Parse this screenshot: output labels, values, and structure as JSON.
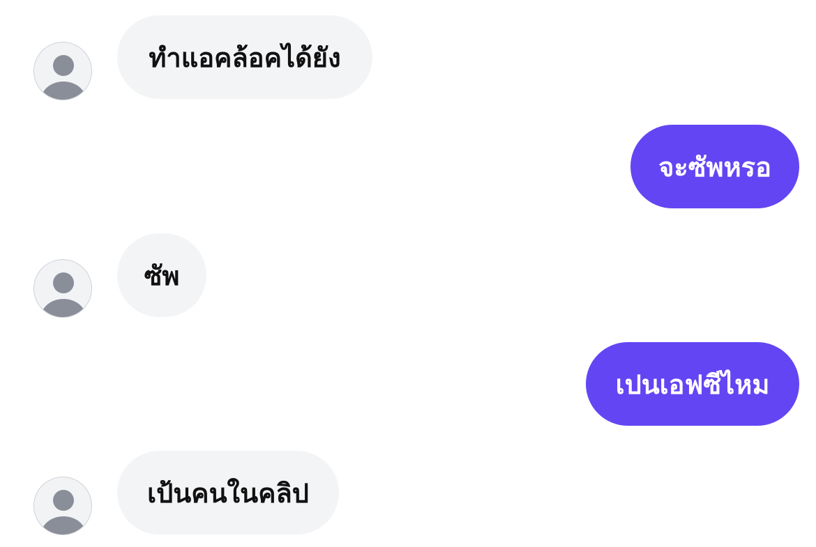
{
  "colors": {
    "incoming_bubble": "#f3f4f6",
    "outgoing_bubble": "#6445f3",
    "incoming_text": "#111111",
    "outgoing_text": "#ffffff",
    "avatar_figure": "#8a8e99"
  },
  "messages": [
    {
      "direction": "incoming",
      "text": "ทำแอคล้อคได้ยัง",
      "avatar": "default-user-icon"
    },
    {
      "direction": "outgoing",
      "text": "จะซัพหรอ"
    },
    {
      "direction": "incoming",
      "text": "ซัพ",
      "avatar": "default-user-icon"
    },
    {
      "direction": "outgoing",
      "text": "เปนเอฟซีไหม"
    },
    {
      "direction": "incoming",
      "text": "เป้นคนในคลิป",
      "avatar": "default-user-icon"
    }
  ]
}
